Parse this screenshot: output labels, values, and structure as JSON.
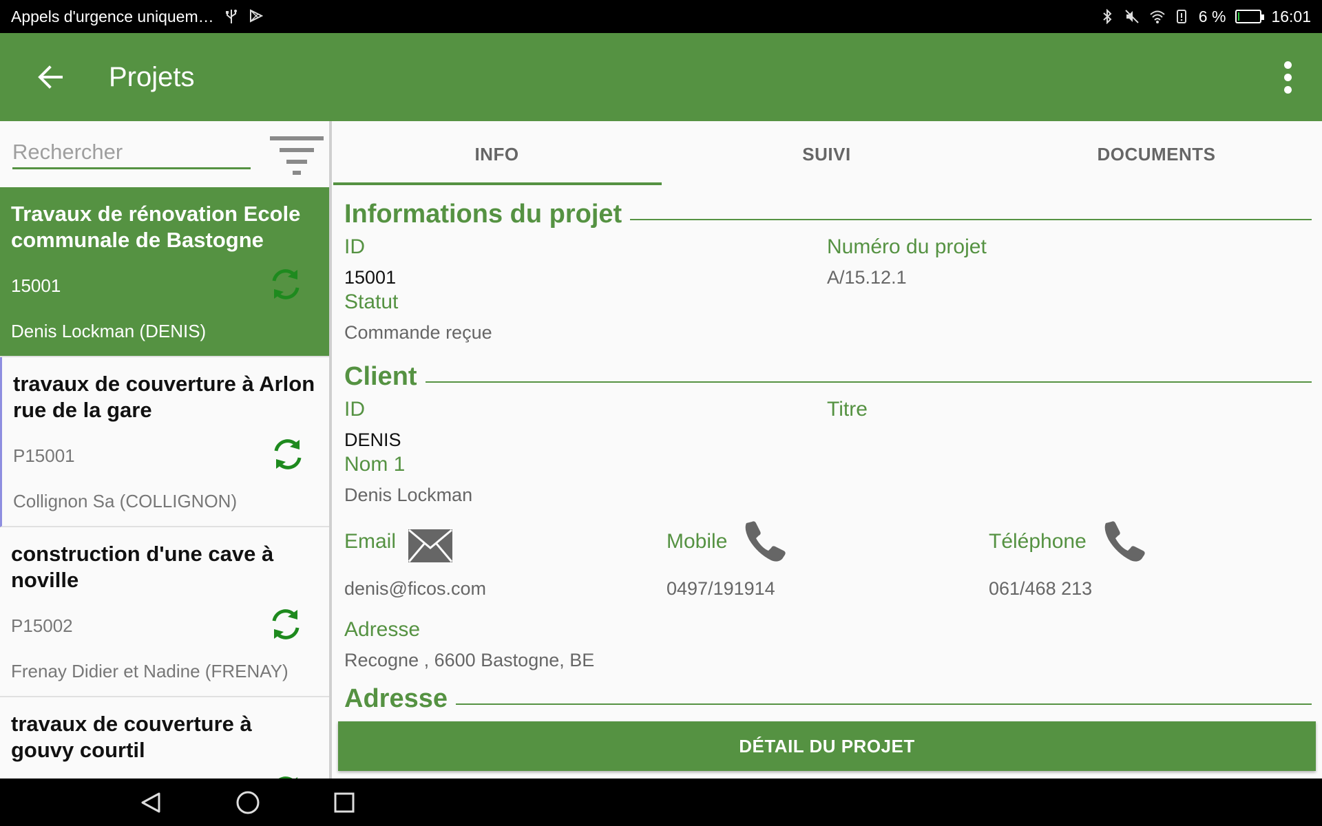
{
  "status_bar": {
    "notification_text": "Appels d'urgence uniquem…",
    "battery_percent": "6 %",
    "battery_level": 0.06,
    "time": "16:01",
    "icons": [
      "usb-icon",
      "play-store-icon",
      "bluetooth-icon",
      "mute-icon",
      "wifi-icon",
      "alert-icon",
      "battery-icon"
    ]
  },
  "appbar": {
    "title": "Projets",
    "back_icon": "arrow-left-icon",
    "menu_icon": "more-vert-icon",
    "color": "#559242"
  },
  "search": {
    "placeholder": "Rechercher",
    "value": ""
  },
  "projects": [
    {
      "title": "Travaux de rénovation Ecole communale de Bastogne",
      "number": "15001",
      "client": "Denis Lockman (DENIS)",
      "selected": true
    },
    {
      "title": "travaux de couverture à Arlon rue de la gare",
      "number": "P15001",
      "client": "Collignon Sa (COLLIGNON)",
      "selected": false
    },
    {
      "title": "construction d'une cave à noville",
      "number": "P15002",
      "client": "Frenay Didier et Nadine (FRENAY)",
      "selected": false
    },
    {
      "title": "travaux de couverture à gouvy courtil",
      "number": "",
      "client": "",
      "selected": false
    }
  ],
  "tabs": [
    {
      "label": "INFO",
      "active": true
    },
    {
      "label": "SUIVI",
      "active": false
    },
    {
      "label": "DOCUMENTS",
      "active": false
    }
  ],
  "project_info": {
    "section_title": "Informations du projet",
    "id_label": "ID",
    "id_value": "15001",
    "number_label": "Numéro du projet",
    "number_value": "A/15.12.1",
    "status_label": "Statut",
    "status_value": "Commande reçue"
  },
  "client": {
    "section_title": "Client",
    "id_label": "ID",
    "id_value": "DENIS",
    "title_label": "Titre",
    "name_label": "Nom 1",
    "name_value": "Denis Lockman",
    "email_label": "Email",
    "email_value": "denis@ficos.com",
    "mobile_label": "Mobile",
    "mobile_value": "0497/191914",
    "phone_label": "Téléphone",
    "phone_value": "061/468 213",
    "address_label": "Adresse",
    "address_value": "Recogne , 6600 Bastogne, BE"
  },
  "address_section": {
    "section_title": "Adresse"
  },
  "detail_button": "DÉTAIL DU PROJET",
  "accent_color": "#559242"
}
